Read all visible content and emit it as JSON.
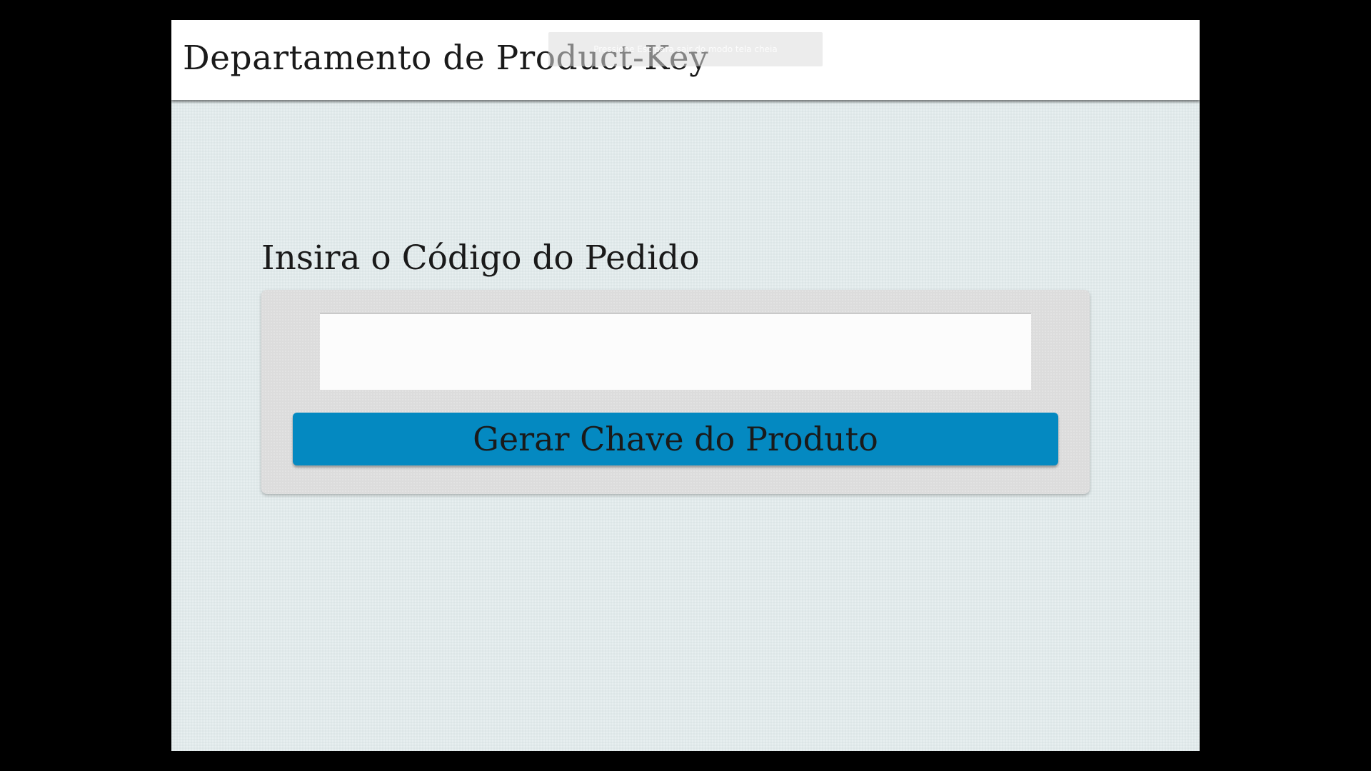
{
  "header": {
    "title": "Departamento de Product-Key",
    "fullscreen_hint": "Pressione Esc para sair do modo tela cheia"
  },
  "form": {
    "label": "Insira o Código do Pedido",
    "order_code_value": "",
    "generate_button_label": "Gerar Chave do Produto"
  },
  "colors": {
    "page_background": "#e1eaeb",
    "header_background": "#ffffff",
    "panel_background": "#dcdcdc",
    "button_background": "#0489c1",
    "letterbox": "#000000"
  }
}
